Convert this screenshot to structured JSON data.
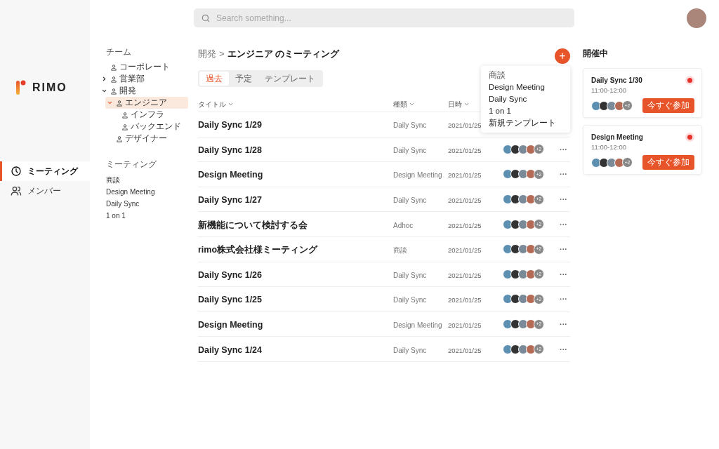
{
  "brand": {
    "name": "RIMO"
  },
  "nav": [
    {
      "label": "ミーティング",
      "selected": true
    },
    {
      "label": "メンバー",
      "selected": false
    }
  ],
  "search": {
    "placeholder": "Search something..."
  },
  "teams": {
    "heading": "チーム",
    "items": [
      {
        "label": "コーポレート",
        "selected": false
      },
      {
        "label": "営業部",
        "selected": false,
        "expanded": false
      },
      {
        "label": "開発",
        "selected": false,
        "expanded": true,
        "children": [
          {
            "label": "エンジニア",
            "selected": true,
            "expanded": true,
            "children": [
              {
                "label": "インフラ",
                "selected": false
              },
              {
                "label": "バックエンド",
                "selected": false
              }
            ]
          },
          {
            "label": "デザイナー",
            "selected": false
          }
        ]
      }
    ]
  },
  "meeting_types": {
    "heading": "ミーティング",
    "items": [
      "商談",
      "Design Meeting",
      "Daily Sync",
      "1 on 1"
    ]
  },
  "breadcrumb": {
    "parent": "開発",
    "separator": ">",
    "current": "エンジニア のミーティング"
  },
  "add_button": {
    "label": "+"
  },
  "tabs": [
    {
      "label": "過去",
      "selected": true
    },
    {
      "label": "予定",
      "selected": false
    },
    {
      "label": "テンプレート",
      "selected": false
    }
  ],
  "table": {
    "columns": [
      "タイトル",
      "種類",
      "日時"
    ],
    "rows": [
      {
        "title": "Daily Sync 1/29",
        "type": "Daily Sync",
        "date": "2021/01/25"
      },
      {
        "title": "Daily Sync 1/28",
        "type": "Daily Sync",
        "date": "2021/01/25",
        "more": "+2",
        "menu": "···"
      },
      {
        "title": "Design Meeting",
        "type": "Design Meeting",
        "date": "2021/01/25",
        "more": "+2",
        "menu": "···"
      },
      {
        "title": "Daily Sync 1/27",
        "type": "Daily Sync",
        "date": "2021/01/25",
        "more": "+2",
        "menu": "···"
      },
      {
        "title": "新機能について検討する会",
        "type": "Adhoc",
        "date": "2021/01/25",
        "more": "+2",
        "menu": "···"
      },
      {
        "title": "rimo株式会社様ミーティング",
        "type": "商談",
        "date": "2021/01/25",
        "more": "+2",
        "menu": "···"
      },
      {
        "title": "Daily Sync 1/26",
        "type": "Daily Sync",
        "date": "2021/01/25",
        "more": "+2",
        "menu": "···"
      },
      {
        "title": "Daily Sync 1/25",
        "type": "Daily Sync",
        "date": "2021/01/25",
        "more": "+2",
        "menu": "···"
      },
      {
        "title": "Design Meeting",
        "type": "Design Meeting",
        "date": "2021/01/25",
        "more": "+2",
        "menu": "···"
      },
      {
        "title": "Daily Sync 1/24",
        "type": "Daily Sync",
        "date": "2021/01/25",
        "more": "+2",
        "menu": "···"
      }
    ]
  },
  "template_menu": {
    "items": [
      {
        "label": "商談",
        "kind": "muted"
      },
      {
        "label": "Design Meeting",
        "kind": "normal"
      },
      {
        "label": "Daily Sync",
        "kind": "normal"
      },
      {
        "label": "1 on 1",
        "kind": "normal"
      },
      {
        "label": "新規テンプレート",
        "kind": "normal"
      }
    ]
  },
  "live": {
    "heading": "開催中",
    "cards": [
      {
        "title": "Daily Sync 1/30",
        "time": "11:00-12:00",
        "live": true,
        "more": "+2",
        "button": "今すぐ参加"
      },
      {
        "title": "Design Meeting",
        "time": "11:00-12:00",
        "live": true,
        "more": "+2",
        "button": "今すぐ参加"
      }
    ]
  }
}
